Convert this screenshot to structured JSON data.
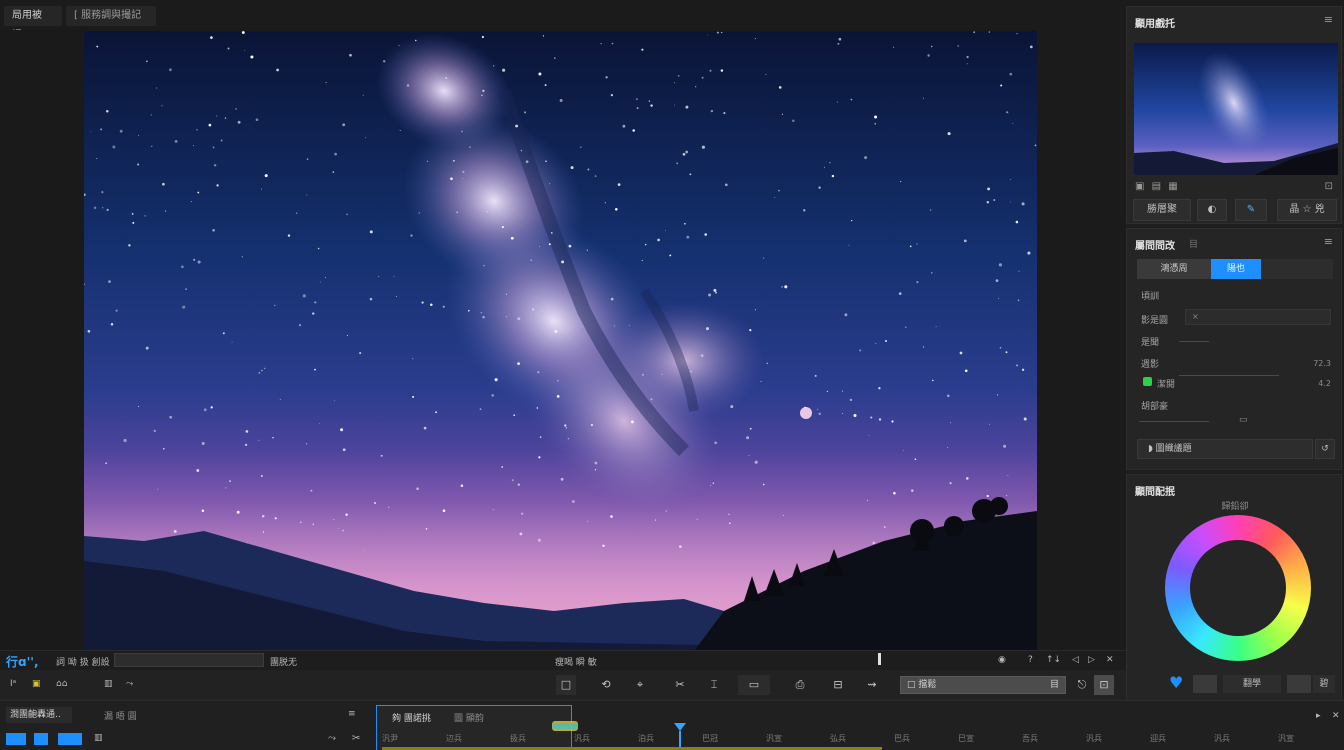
{
  "tabs": [
    {
      "label": "局用被提..."
    },
    {
      "label": "[ 服務調與撮記"
    }
  ],
  "navigator": {
    "title": "顯用戲托",
    "icons": [
      "▣",
      "▤",
      "▦"
    ],
    "buttons": [
      {
        "label": "勝層聚"
      },
      {
        "label": "◐"
      },
      {
        "label": "✎"
      },
      {
        "label": "晶 ☆ 兇"
      }
    ]
  },
  "properties": {
    "title": "屬問問改",
    "subtitle": "目",
    "segments": [
      {
        "label": "鴻憑周"
      },
      {
        "label": "陽也"
      }
    ],
    "rows": [
      {
        "label": "頃訓",
        "value": ""
      },
      {
        "label": "影是圓",
        "value": "×"
      },
      {
        "label": "是聞",
        "value": ""
      },
      {
        "label": "週影",
        "value": "72.3"
      },
      {
        "label": "潔閱",
        "value": "4.2"
      },
      {
        "label": "胡部豪",
        "value": ""
      }
    ],
    "footer": "圖織議題"
  },
  "colors_panel": {
    "title": "顯問配抿",
    "caption": "歸鉛卻",
    "bottom_labels": [
      "翻學",
      "碧"
    ]
  },
  "bar1": {
    "logo": "行ɑ'',",
    "left_label": "詞 呦 扱 創設",
    "mid_label": "團脱无",
    "center_label": "瘦喝 瞬 敏",
    "right_icons": [
      "◉",
      "?",
      "↑↓",
      "◁",
      "▷",
      "✕"
    ]
  },
  "bar2": {
    "left_items": [
      "Iᵃ",
      "▣",
      "⌂⌂"
    ],
    "input_label": "□ 擋鬆",
    "input_value": "目",
    "tools": [
      "□",
      "⟲",
      "⌖",
      "✂",
      "⌶",
      "▭",
      "⎙",
      "⊟",
      "⇝"
    ]
  },
  "timeline": {
    "title": "澗團齙轟通..",
    "sub1": "漏 晤 圓",
    "tab_active": "夠 團諾挑",
    "tab_other": "圖 顯韵",
    "ruler_labels": [
      "汎尹",
      "辺兵",
      "扱兵",
      "汎兵",
      "泊兵",
      "巴冠",
      "汎宣",
      "弘兵",
      "巴兵",
      "巳宣",
      "吾兵",
      "汎兵",
      "迎兵",
      "汎兵",
      "汎宣"
    ]
  },
  "colors": {
    "accent": "#1e8fff",
    "teal": "#34c0d0",
    "yellow": "#d8c23a",
    "green": "#2ed04a"
  }
}
